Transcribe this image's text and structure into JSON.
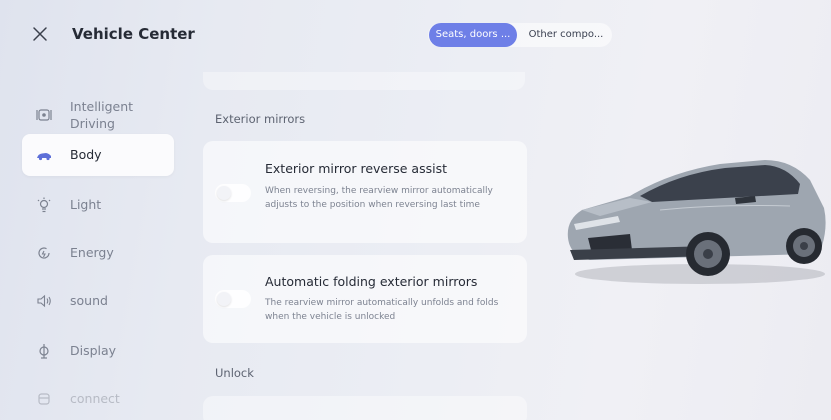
{
  "header": {
    "title": "Vehicle Center",
    "close_icon": "close-icon"
  },
  "tabs": [
    {
      "label": "Seats, doors ...",
      "active": true
    },
    {
      "label": "Other compo...",
      "active": false
    }
  ],
  "sidebar": {
    "items": [
      {
        "label": "Intelligent\nDriving",
        "icon": "steering-icon"
      },
      {
        "label": "Body",
        "icon": "car-body-icon",
        "active": true
      },
      {
        "label": "Light",
        "icon": "light-icon"
      },
      {
        "label": "Energy",
        "icon": "energy-icon"
      },
      {
        "label": "sound",
        "icon": "speaker-icon"
      },
      {
        "label": "Display",
        "icon": "display-icon"
      },
      {
        "label": "connect",
        "icon": "connect-icon",
        "disabled": true
      }
    ]
  },
  "main": {
    "section_exterior": "Exterior mirrors",
    "cards": [
      {
        "title": "Exterior mirror reverse assist",
        "description": "When reversing, the rearview mirror automatically adjusts to the position when reversing last time",
        "enabled": false
      },
      {
        "title": "Automatic folding exterior mirrors",
        "description": "The rearview mirror automatically unfolds and folds when the vehicle is unlocked",
        "enabled": false
      }
    ],
    "section_unlock": "Unlock"
  },
  "colors": {
    "accent": "#6e7fe7",
    "car_body": "#9ea6b0"
  }
}
